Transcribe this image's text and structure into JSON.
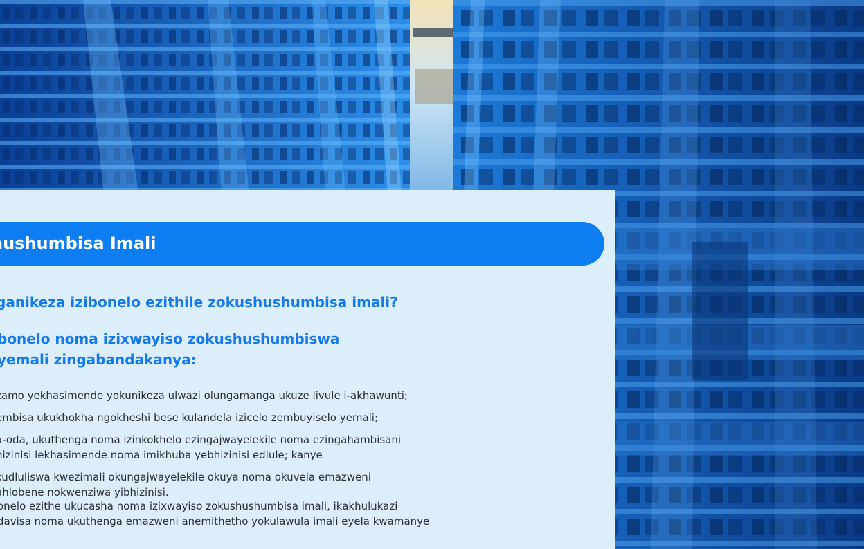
{
  "banner": {
    "title": "hushumbisa Imali"
  },
  "question": "ganikeza izibonelo ezithile zokushushumbisa imali?",
  "subheading": {
    "line1": "bonelo noma izixwayiso zokushushumbiswa",
    "line2": "yemali zingabandakanya:"
  },
  "list_items": [
    {
      "lines": [
        "zamo yekhasimende yokunikeza ulwazi olungamanga ukuze livule i-akhawunti;"
      ]
    },
    {
      "lines": [
        "embisa ukukhokha ngokheshi bese kulandela izicelo zembuyiselo yemali;"
      ]
    },
    {
      "lines": [
        "a-oda, ukuthenga noma izinkokhelo ezingajwayelekile noma ezingahambisani",
        "hizinisi lekhasimende noma imikhuba yebhizinisi edlule; kanye"
      ]
    },
    {
      "lines": [
        "kudluliswa kwezimali okungajwayelekile okuya noma okuvela emazweni",
        "ahlobene nokwenziwa yibhizinisi."
      ]
    }
  ],
  "paragraph": {
    "line1": "onelo ezithe ukucasha noma izixwayiso zokushushumbisa imali, ikakhulukazi",
    "line2": "davisa noma ukuthenga emazweni anemithetho yokulawula imali eyela kwamanye"
  },
  "colors": {
    "banner": "#0d7df2",
    "heading": "#1479ea",
    "panel": "#ddeefb",
    "body_text": "#2a2f36"
  }
}
